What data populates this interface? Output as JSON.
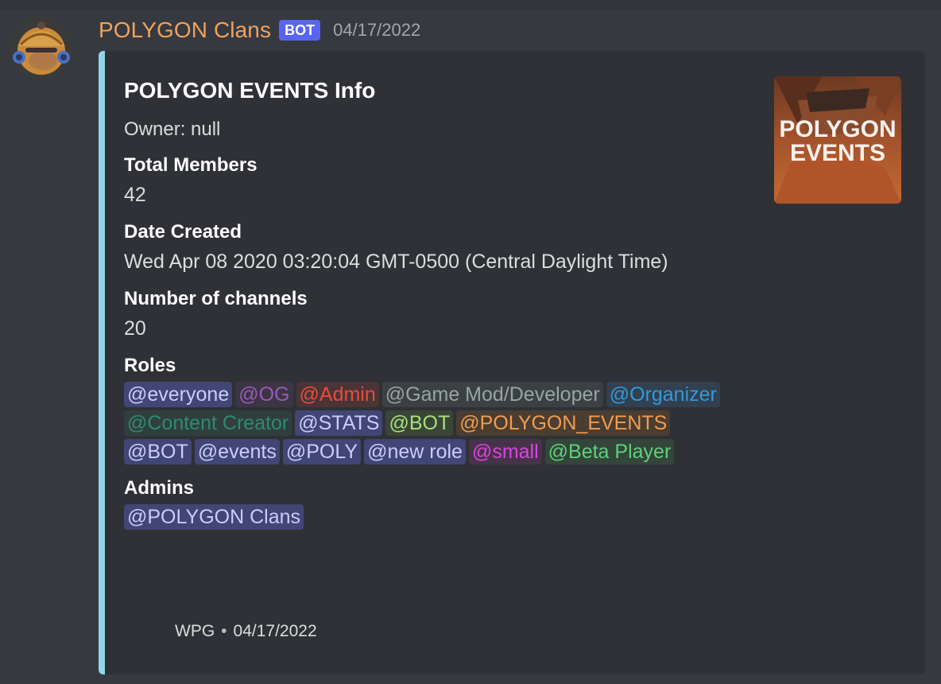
{
  "message": {
    "username": "POLYGON Clans",
    "bot_tag": "BOT",
    "timestamp": "04/17/2022",
    "avatar_icon": "avatar-mechanic-icon"
  },
  "embed": {
    "accent_color": "#8fd6e8",
    "title": "POLYGON EVENTS Info",
    "description": "Owner: null",
    "thumbnail_text": [
      "POLYGON",
      "EVENTS"
    ],
    "fields": {
      "members_name": "Total Members",
      "members_value": "42",
      "created_name": "Date Created",
      "created_value": "Wed Apr 08 2020 03:20:04 GMT-0500 (Central Daylight Time)",
      "channels_name": "Number of channels",
      "channels_value": "20",
      "roles_name": "Roles",
      "admins_name": "Admins"
    },
    "roles": [
      {
        "label": "@everyone",
        "color": "#c9cdfb",
        "bg": "#414675"
      },
      {
        "label": "@OG",
        "color": "#9b59b6",
        "bg": "#3b3545"
      },
      {
        "label": "@Admin",
        "color": "#e74c3c",
        "bg": "#4a3436"
      },
      {
        "label": "@Game Mod/Developer",
        "color": "#95a5a6",
        "bg": "#3c4042"
      },
      {
        "label": "@Organizer",
        "color": "#3498db",
        "bg": "#32404f"
      },
      {
        "label": "@Content Creator",
        "color": "#2e8b6e",
        "bg": "#303f3d"
      },
      {
        "label": "@STATS",
        "color": "#c9cdfb",
        "bg": "#414675"
      },
      {
        "label": "@BOT",
        "color": "#a6e07a",
        "bg": "#3a4538"
      },
      {
        "label": "@POLYGON_EVENTS",
        "color": "#f39c4b",
        "bg": "#4a3d32"
      },
      {
        "label": "@BOT",
        "color": "#c9cdfb",
        "bg": "#414675"
      },
      {
        "label": "@events",
        "color": "#c9cdfb",
        "bg": "#414675"
      },
      {
        "label": "@POLY",
        "color": "#c9cdfb",
        "bg": "#414675"
      },
      {
        "label": "@new role",
        "color": "#c9cdfb",
        "bg": "#414675"
      },
      {
        "label": "@small",
        "color": "#d944e0",
        "bg": "#473349"
      },
      {
        "label": "@Beta Player",
        "color": "#5fd07a",
        "bg": "#34453a"
      }
    ],
    "admins": [
      {
        "label": "@POLYGON Clans",
        "color": "#c9cdfb",
        "bg": "#414675"
      }
    ],
    "footer": {
      "text": "WPG",
      "separator": "•",
      "timestamp": "04/17/2022"
    }
  }
}
